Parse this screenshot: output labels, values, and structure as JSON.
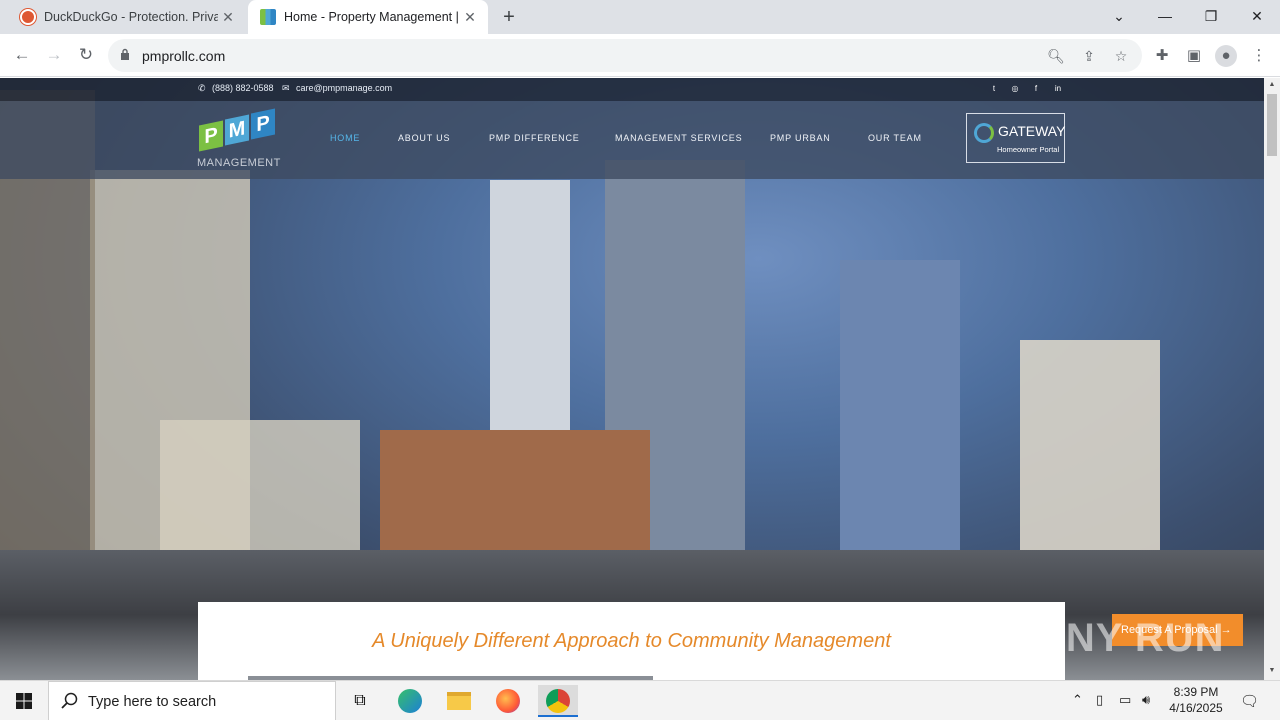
{
  "browser": {
    "tabs": [
      {
        "title": "DuckDuckGo - Protection. Privac",
        "active": false
      },
      {
        "title": "Home - Property Management |",
        "active": true
      }
    ],
    "url": "pmprollc.com"
  },
  "site": {
    "contact_phone": "(888) 882-0588",
    "contact_email": "care@pmpmanage.com",
    "logo": {
      "letters": [
        "P",
        "M",
        "P"
      ],
      "subtitle": "MANAGEMENT"
    },
    "nav": [
      "HOME",
      "ABOUT US",
      "PMP DIFFERENCE",
      "MANAGEMENT SERVICES",
      "PMP URBAN",
      "OUR TEAM"
    ],
    "gateway": {
      "title": "GATEWAY",
      "subtitle": "Homeowner Portal"
    },
    "headline": "A Uniquely Different Approach to Community Management",
    "proposal_button": "Request A Proposal →",
    "watermark": "ANY RUN"
  },
  "taskbar": {
    "search_placeholder": "Type here to search",
    "time": "8:39 PM",
    "date": "4/16/2025"
  },
  "colors": {
    "accent_orange": "#e5892a",
    "nav_active": "#55b7ea",
    "proposal": "#f28d2b"
  }
}
